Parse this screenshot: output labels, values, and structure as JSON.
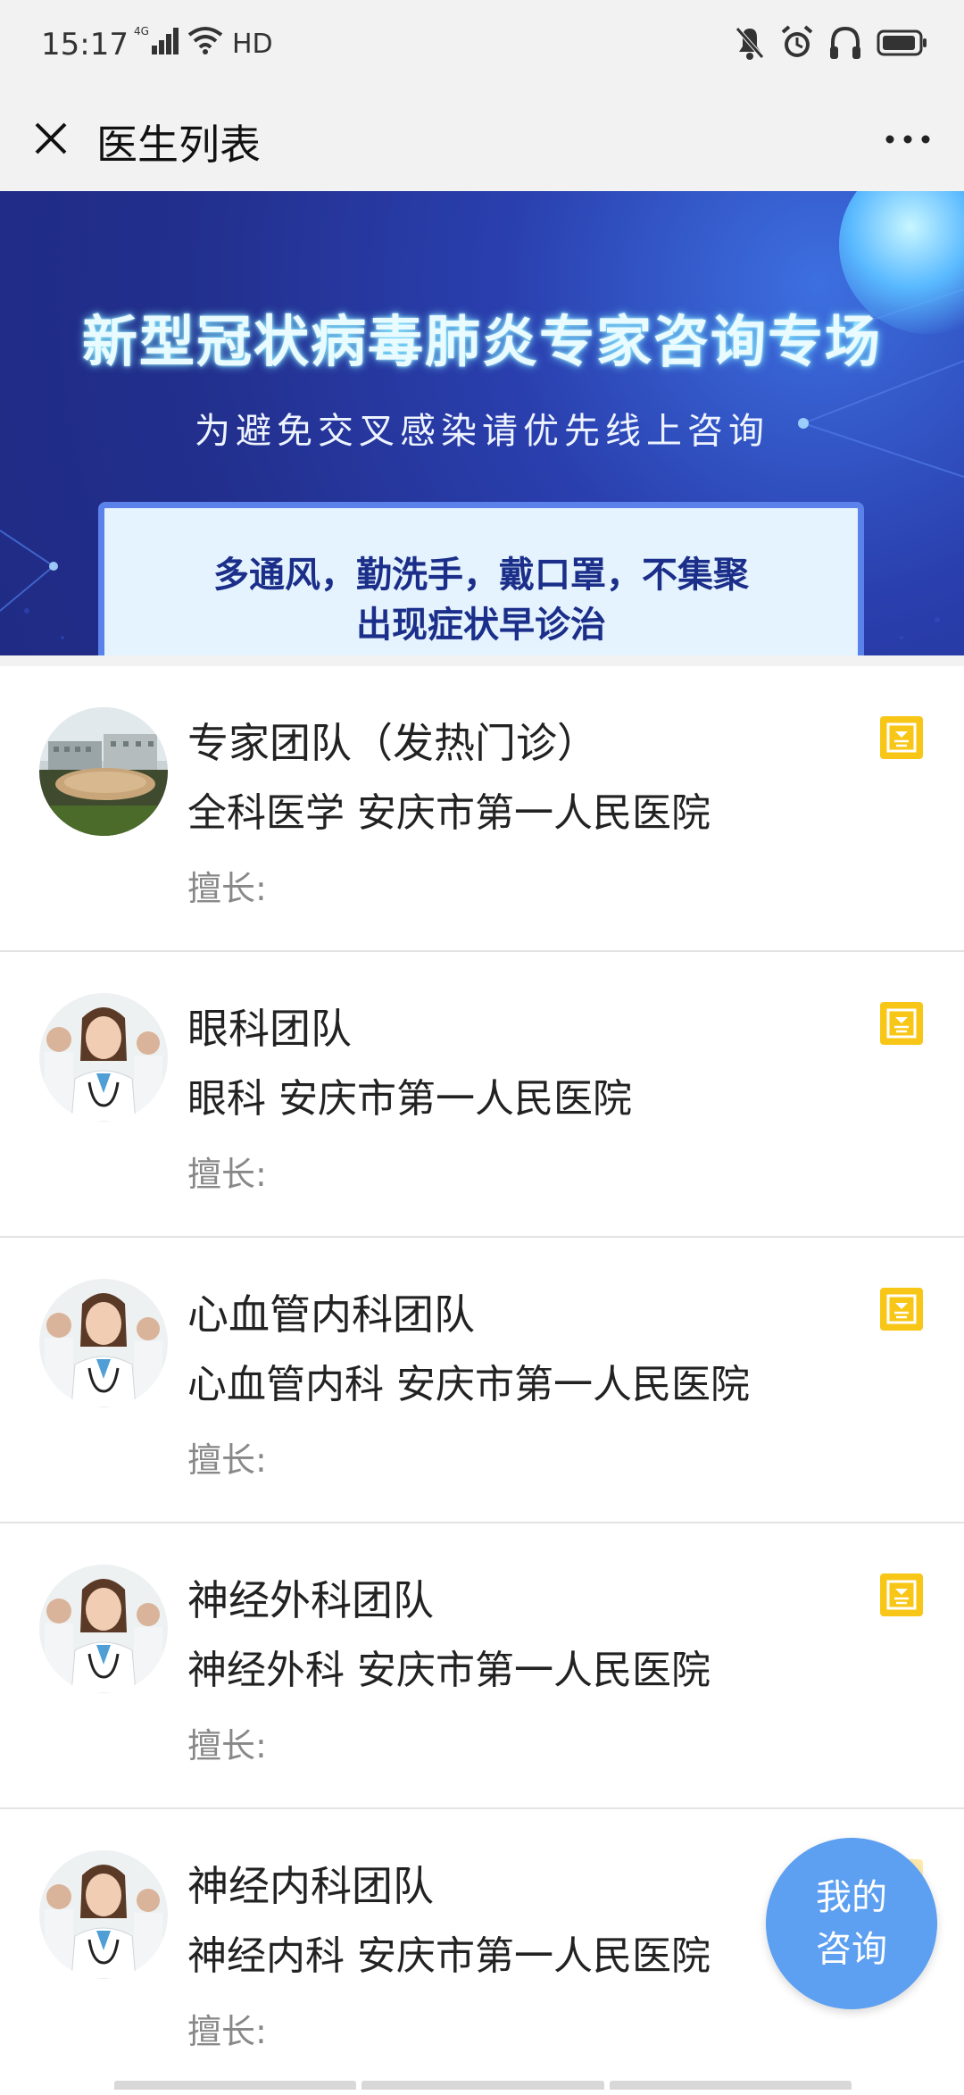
{
  "status_bar": {
    "time": "15:17",
    "network": "4G",
    "hd": "HD"
  },
  "header": {
    "title": "医生列表"
  },
  "banner": {
    "title": "新型冠状病毒肺炎专家咨询专场",
    "subtitle": "为避免交叉感染请优先线上咨询",
    "tip_line1": "多通风，勤洗手，戴口罩，不集聚",
    "tip_line2": "出现症状早诊治"
  },
  "doctors": [
    {
      "name": "专家团队（发热门诊）",
      "dept": "全科医学 安庆市第一人民医院",
      "specialty": "擅长:",
      "avatar": "hospital-photo",
      "badge_icon": "image-consult-icon"
    },
    {
      "name": "眼科团队",
      "dept": "眼科 安庆市第一人民医院",
      "specialty": "擅长:",
      "avatar": "doctor-photo",
      "badge_icon": "image-consult-icon"
    },
    {
      "name": "心血管内科团队",
      "dept": "心血管内科 安庆市第一人民医院",
      "specialty": "擅长:",
      "avatar": "doctor-photo",
      "badge_icon": "image-consult-icon"
    },
    {
      "name": "神经外科团队",
      "dept": "神经外科 安庆市第一人民医院",
      "specialty": "擅长:",
      "avatar": "doctor-photo",
      "badge_icon": "image-consult-icon"
    },
    {
      "name": "神经内科团队",
      "dept": "神经内科 安庆市第一人民医院",
      "specialty": "擅长:",
      "avatar": "doctor-photo",
      "badge_icon": "image-consult-icon"
    }
  ],
  "fab": {
    "line1": "我的",
    "line2": "咨询"
  },
  "colors": {
    "badge": "#f8c616",
    "fab": "#5d9ff0",
    "banner": "#222f8d"
  }
}
